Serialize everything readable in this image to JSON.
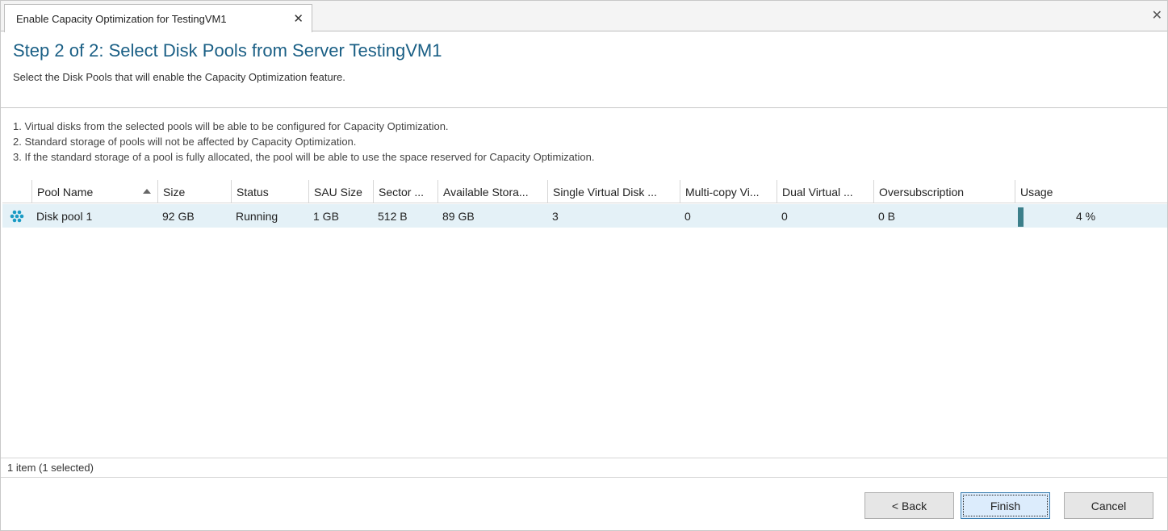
{
  "tab": {
    "title": "Enable Capacity Optimization for TestingVM1",
    "close": "✕"
  },
  "window_close": "✕",
  "header": {
    "title": "Step 2 of 2: Select Disk Pools from Server TestingVM1",
    "subtitle": "Select the Disk Pools that will enable the Capacity Optimization feature."
  },
  "notes": [
    "1. Virtual disks from the selected pools will be able to be configured for Capacity Optimization.",
    "2. Standard storage of pools will not be affected by Capacity Optimization.",
    "3. If the standard storage of a pool is fully allocated, the pool will be able to use the space reserved for Capacity Optimization."
  ],
  "table": {
    "columns": [
      "Pool Name",
      "Size",
      "Status",
      "SAU Size",
      "Sector ...",
      "Available Stora...",
      "Single Virtual Disk ...",
      "Multi-copy Vi...",
      "Dual Virtual ...",
      "Oversubscription",
      "Usage"
    ],
    "sort_column": "Pool Name",
    "rows": [
      {
        "icon": "disk-pool-icon",
        "pool_name": "Disk pool 1",
        "size": "92 GB",
        "status": "Running",
        "sau_size": "1 GB",
        "sector": "512 B",
        "available": "89 GB",
        "single_vd": "3",
        "multi_copy": "0",
        "dual_virtual": "0",
        "oversubscription": "0 B",
        "usage": "4 %",
        "usage_value": 0.04
      }
    ]
  },
  "status_bar": "1 item (1 selected)",
  "buttons": {
    "back": "< Back",
    "finish": "Finish",
    "cancel": "Cancel"
  },
  "colors": {
    "title": "#1a5f85",
    "selected_row": "#e4f1f7",
    "usage_bar": "#3c7f8a",
    "icon": "#1a9bc4"
  }
}
